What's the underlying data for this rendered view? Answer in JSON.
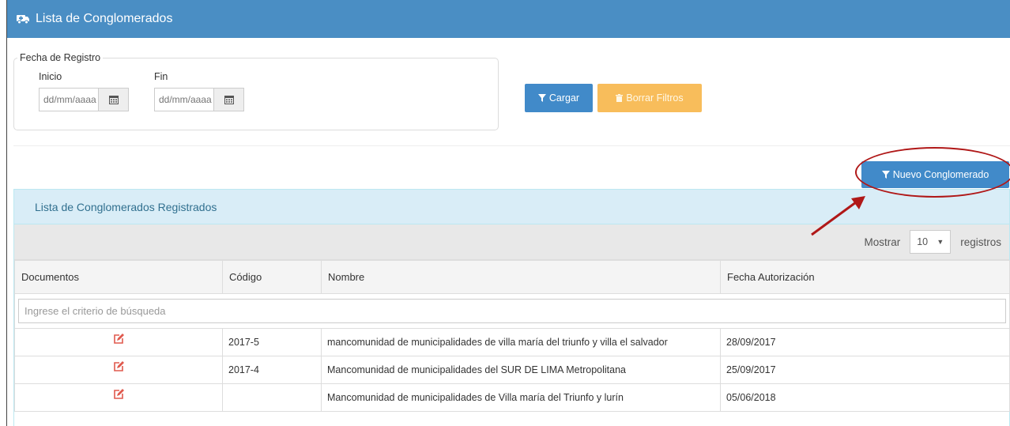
{
  "header": {
    "title": "Lista de Conglomerados",
    "icon": "ambulance-icon"
  },
  "filters": {
    "legend": "Fecha de Registro",
    "inicio_label": "Inicio",
    "fin_label": "Fin",
    "inicio_placeholder": "dd/mm/aaaa",
    "fin_placeholder": "dd/mm/aaaa",
    "cargar_label": "Cargar",
    "borrar_label": "Borrar Filtros"
  },
  "actions": {
    "nuevo_label": "Nuevo Conglomerado"
  },
  "panel": {
    "title": "Lista de Conglomerados Registrados",
    "mostrar_label": "Mostrar",
    "page_size": "10",
    "registros_label": "registros",
    "search_placeholder": "Ingrese el criterio de búsqueda",
    "columns": [
      "Documentos",
      "Código",
      "Nombre",
      "Fecha Autorización"
    ],
    "rows": [
      {
        "codigo": "2017-5",
        "nombre": "mancomunidad de municipalidades de villa maría del triunfo y villa el salvador",
        "fecha": "28/09/2017"
      },
      {
        "codigo": "2017-4",
        "nombre": "Mancomunidad de municipalidades del SUR DE LIMA Metropolitana",
        "fecha": "25/09/2017"
      },
      {
        "codigo": "",
        "nombre": "Mancomunidad de municipalidades de Villa maría del Triunfo y lurín",
        "fecha": "05/06/2018"
      }
    ]
  },
  "colors": {
    "header": "#4a8ec4",
    "primary": "#418ac9",
    "warning": "#f8bd5b",
    "annotation": "#b01818",
    "edit_icon": "#e05a4e"
  }
}
